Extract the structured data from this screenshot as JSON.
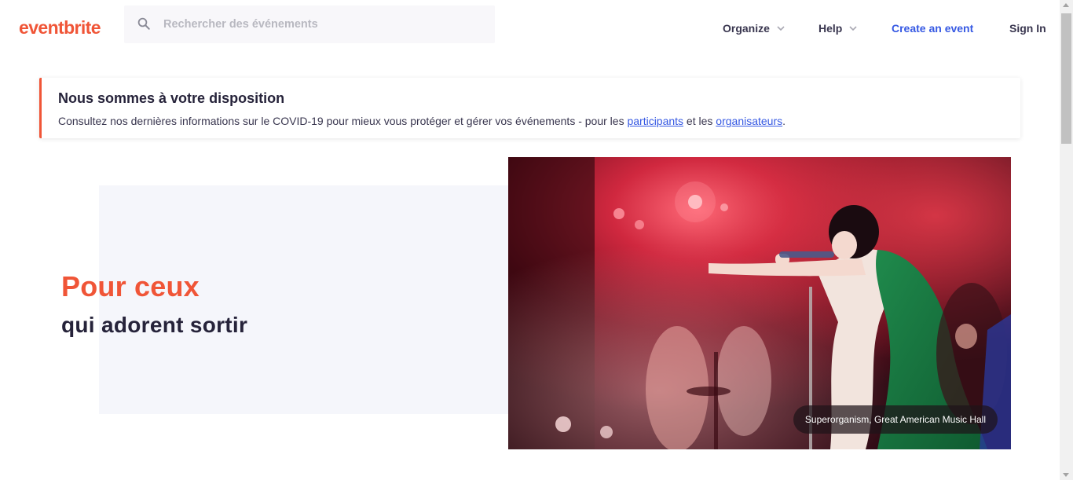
{
  "header": {
    "logo": "eventbrite",
    "search": {
      "placeholder": "Rechercher des événements",
      "value": ""
    },
    "nav": {
      "organize": "Organize",
      "help": "Help",
      "create_event": "Create an event",
      "sign_in": "Sign In"
    }
  },
  "banner": {
    "title": "Nous sommes à votre disposition",
    "text_before": "Consultez nos dernières informations sur le COVID-19 pour mieux vous protéger et gérer vos événements - pour les ",
    "link_participants": "participants",
    "text_middle": " et les ",
    "link_organizers": "organisateurs",
    "text_after": "."
  },
  "hero": {
    "title": "Pour ceux",
    "subtitle": "qui adorent sortir",
    "image_caption": "Superorganism, Great American Music Hall"
  },
  "colors": {
    "brand": "#f05537",
    "link": "#3659e3",
    "text_dark": "#26233a",
    "hero_bg": "#f5f6fb"
  },
  "icons": {
    "search": "search-icon",
    "organize_dropdown": "chevron-down-icon",
    "help_dropdown": "chevron-down-icon"
  }
}
